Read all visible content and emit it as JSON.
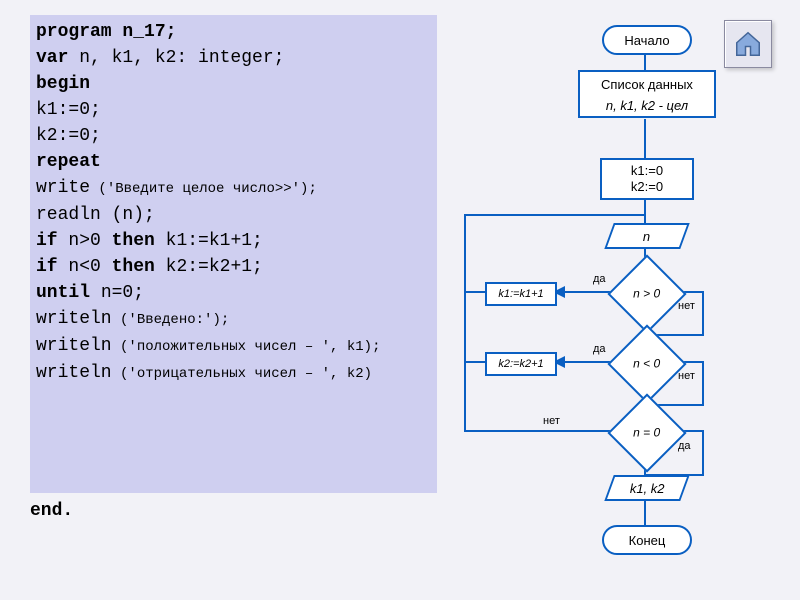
{
  "code": {
    "l1": "program n_17;",
    "l2_pre": "   ",
    "l2_kw": "var",
    "l2_rest": " n, k1, k2: integer;",
    "l3": "begin",
    "l4": "   k1:=0;",
    "l5": "   k2:=0;",
    "l6_pre": "   ",
    "l6_kw": "repeat",
    "l7a": "      write",
    "l7b": " ('Введите целое число>>');",
    "l8": "      readln (n);",
    "l9_pre": "      ",
    "l9_if": "if",
    "l9_mid": " n>0 ",
    "l9_then": "then",
    "l9_rest": " k1:=k1+1;",
    "l10_pre": "      ",
    "l10_if": "if",
    "l10_mid": " n<0 ",
    "l10_then": "then",
    "l10_rest": " k2:=k2+1;",
    "l11_pre": "   ",
    "l11_kw": "until",
    "l11_rest": " n=0;",
    "l12a": "   writeln",
    "l12b": " ('Введено:');",
    "l13a": "   writeln",
    "l13b": " ('положительных чисел – ', k1);",
    "l14a": "      writeln",
    "l14b": " ('отрицательных  чисел – ', k2)",
    "l15": "end."
  },
  "flow": {
    "start": "Начало",
    "list": "Список данных",
    "vars": "n, k1, k2 - цел",
    "init_l1": "k1:=0",
    "init_l2": "k2:=0",
    "input_n": "n",
    "cond1": "n > 0",
    "cond2": "n < 0",
    "cond3": "n = 0",
    "act1": "k1:=k1+1",
    "act2": "k2:=k2+1",
    "output": "k1, k2",
    "end": "Конец",
    "yes": "да",
    "no": "нет"
  },
  "icons": {
    "home": "home-icon"
  },
  "colors": {
    "accent": "#0a5fc2",
    "code_bg": "#cfcff0"
  }
}
